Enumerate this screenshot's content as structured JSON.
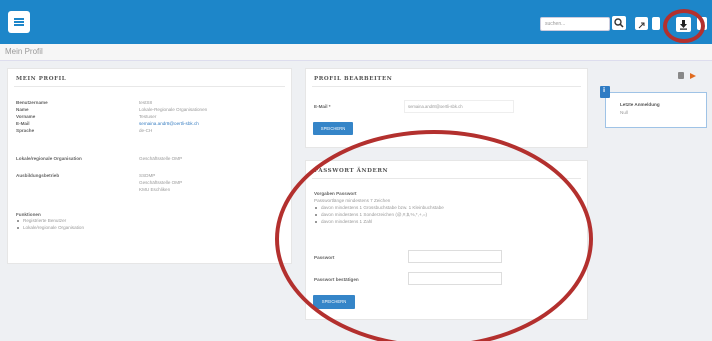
{
  "header": {
    "search_placeholder": "suchen..."
  },
  "page": {
    "title": "Mein Profil"
  },
  "profile": {
    "heading": "MEIN PROFIL",
    "rows": [
      {
        "label": "Benutzername",
        "value": "testS8"
      },
      {
        "label": "Name",
        "value": "Lokale-Regionale Organisationen"
      },
      {
        "label": "Vorname",
        "value": "Testuser"
      },
      {
        "label": "E-Mail",
        "value": "semaina.andr8@oertli-sbk.ch"
      },
      {
        "label": "Sprache",
        "value": "de-CH"
      }
    ],
    "org_label": "Lokale/regionale Organisation",
    "org_value": "Geschäftsstelle OMP",
    "company_label": "Ausbildungsbetrieb",
    "company_values": [
      "SSDMP",
      "Geschäftsstelle OMP",
      "KMU Eschliken"
    ],
    "functions_label": "Funktionen",
    "functions": [
      "Registrierte Benutzer",
      "Lokale/regionale Organisation"
    ]
  },
  "edit_profile": {
    "heading": "PROFIL BEARBEITEN",
    "email_label": "E-Mail *",
    "email_value": "semaina.andr8@oertli-sbk.ch",
    "save_label": "SPEICHERN"
  },
  "change_password": {
    "heading": "PASSWORT ÄNDERN",
    "rules_title": "Vorgaben Passwort",
    "rules_intro": "Passwortlänge mindestens 7 Zeichen",
    "rules": [
      "davon mindestens 1 Grossbuchstabe bzw. 1 Kleinbuchstabe",
      "davon mindestens 1 Sonderzeichen (@,#,$,%,*,+,=)",
      "davon mindestens 1 Zahl"
    ],
    "password_label": "Passwort",
    "confirm_label": "Passwort bestätigen",
    "save_label": "SPEICHERN"
  },
  "side": {
    "title": "Letzte Anmeldung",
    "value": "Null"
  },
  "colors": {
    "topbar": "#1d86c9",
    "button": "#3585c8",
    "annotation": "#b3302e"
  },
  "icons": [
    "menu-icon",
    "search-icon",
    "expand-icon",
    "back-icon",
    "download-icon",
    "forward-icon",
    "info-icon",
    "lock-icon",
    "play-icon"
  ]
}
